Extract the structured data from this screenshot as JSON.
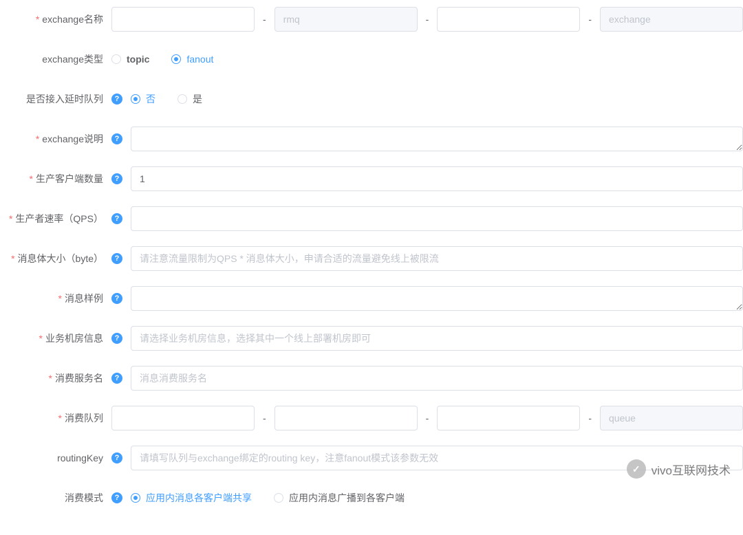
{
  "fields": {
    "exchange_name": {
      "label": "exchange名称",
      "seg2_placeholder": "rmq",
      "seg4_placeholder": "exchange"
    },
    "exchange_type": {
      "label": "exchange类型",
      "opt_topic": "topic",
      "opt_fanout": "fanout"
    },
    "delay_queue": {
      "label": "是否接入延时队列",
      "opt_no": "否",
      "opt_yes": "是"
    },
    "exchange_desc": {
      "label": "exchange说明"
    },
    "producer_client_count": {
      "label": "生产客户端数量",
      "value": "1"
    },
    "producer_qps": {
      "label": "生产者速率（QPS）"
    },
    "message_size": {
      "label": "消息体大小（byte）",
      "placeholder": "请注意流量限制为QPS * 消息体大小，申请合适的流量避免线上被限流"
    },
    "message_sample": {
      "label": "消息样例"
    },
    "biz_room": {
      "label": "业务机房信息",
      "placeholder": "请选择业务机房信息，选择其中一个线上部署机房即可"
    },
    "consumer_service": {
      "label": "消费服务名",
      "placeholder": "消息消费服务名"
    },
    "consumer_queue": {
      "label": "消费队列",
      "seg4_placeholder": "queue"
    },
    "routing_key": {
      "label": "routingKey",
      "placeholder": "请填写队列与exchange绑定的routing key，注意fanout模式该参数无效"
    },
    "consume_mode": {
      "label": "消费模式",
      "opt_shared": "应用内消息各客户端共享",
      "opt_broadcast": "应用内消息广播到各客户端"
    }
  },
  "watermark": "vivo互联网技术"
}
